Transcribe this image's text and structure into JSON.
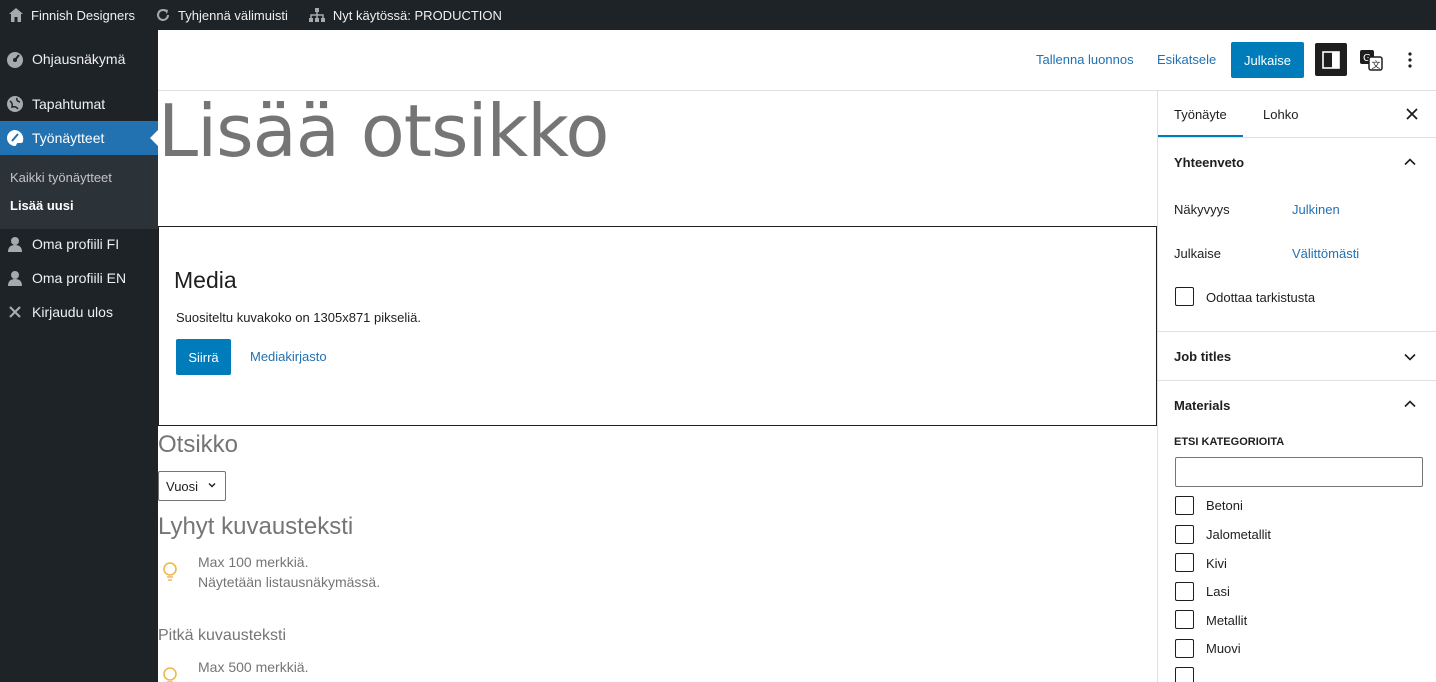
{
  "adminbar": {
    "site_name": "Finnish Designers",
    "clear_cache": "Tyhjennä välimuisti",
    "environment": "Nyt käytössä: PRODUCTION"
  },
  "sidebar": {
    "items": [
      {
        "label": "Ohjausnäkymä",
        "icon": "dashboard-icon"
      },
      {
        "label": "Tapahtumat",
        "icon": "globe-icon"
      },
      {
        "label": "Työnäytteet",
        "icon": "palette-icon",
        "active": true
      },
      {
        "label": "Oma profiili FI",
        "icon": "user-icon"
      },
      {
        "label": "Oma profiili EN",
        "icon": "user-icon"
      },
      {
        "label": "Kirjaudu ulos",
        "icon": "close-icon"
      }
    ],
    "submenu": [
      "Kaikki työnäytteet",
      "Lisää uusi"
    ]
  },
  "header": {
    "save_draft": "Tallenna luonnos",
    "preview": "Esikatsele",
    "publish": "Julkaise"
  },
  "editor": {
    "title_placeholder": "Lisää otsikko",
    "media": {
      "title": "Media",
      "description": "Suositeltu kuvakoko on 1305x871 pikseliä.",
      "upload": "Siirrä",
      "library": "Mediakirjasto"
    },
    "field_title": "Otsikko",
    "year_select": "Vuosi",
    "short_desc": {
      "title": "Lyhyt kuvausteksti",
      "hint1": "Max 100 merkkiä.",
      "hint2": "Näytetään listausnäkymässä."
    },
    "long_desc": {
      "title": "Pitkä kuvausteksti",
      "hint1": "Max 500 merkkiä."
    }
  },
  "settings": {
    "tabs": [
      "Työnäyte",
      "Lohko"
    ],
    "summary": {
      "title": "Yhteenveto",
      "visibility_label": "Näkyvyys",
      "visibility_value": "Julkinen",
      "publish_label": "Julkaise",
      "publish_value": "Välittömästi",
      "pending_review": "Odottaa tarkistusta"
    },
    "job_titles": "Job titles",
    "materials": {
      "title": "Materials",
      "search_label": "ETSI KATEGORIOITA",
      "categories": [
        "Betoni",
        "Jalometallit",
        "Kivi",
        "Lasi",
        "Metallit",
        "Muovi"
      ]
    }
  },
  "colors": {
    "adminbar_bg": "#1d2327",
    "accent": "#2271b1",
    "button": "#007cba",
    "hint_icon": "#f0b849"
  }
}
